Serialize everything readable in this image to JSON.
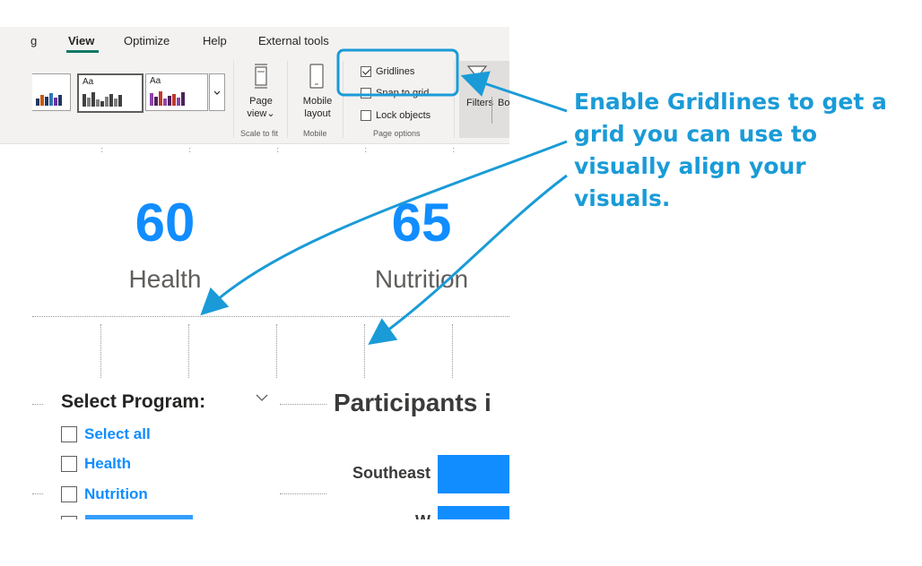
{
  "ribbon": {
    "tabs": [
      {
        "label": "g"
      },
      {
        "label": "View",
        "active": true
      },
      {
        "label": "Optimize"
      },
      {
        "label": "Help"
      },
      {
        "label": "External tools"
      }
    ],
    "theme_swatch_label": "Aa",
    "page_view": {
      "line1": "Page",
      "line2": "view",
      "group": "Scale to fit"
    },
    "mobile_layout": {
      "line1": "Mobile",
      "line2": "layout",
      "group": "Mobile"
    },
    "page_options": {
      "group": "Page options",
      "gridlines": {
        "label": "Gridlines",
        "checked": true
      },
      "snap_to_grid": {
        "label": "Snap to grid",
        "checked": false
      },
      "lock_objects": {
        "label": "Lock objects",
        "checked": false
      }
    },
    "filters": {
      "label": "Filters",
      "next_label": "Bo"
    }
  },
  "cards": [
    {
      "value": "60",
      "label": "Health"
    },
    {
      "value": "65",
      "label": "Nutrition"
    }
  ],
  "slicer": {
    "title": "Select Program:",
    "items": [
      {
        "label": "Select all"
      },
      {
        "label": "Health"
      },
      {
        "label": "Nutrition"
      }
    ]
  },
  "chart": {
    "title": "Participants i",
    "categories": [
      "Southeast",
      "W"
    ]
  },
  "callout": {
    "text": "Enable Gridlines to get a grid you can use to visually align your visuals.",
    "color": "#1a9bd7"
  },
  "colors": {
    "accent": "#118dff",
    "ribbon_bg": "#f3f2f1",
    "active_tab": "#117865"
  }
}
